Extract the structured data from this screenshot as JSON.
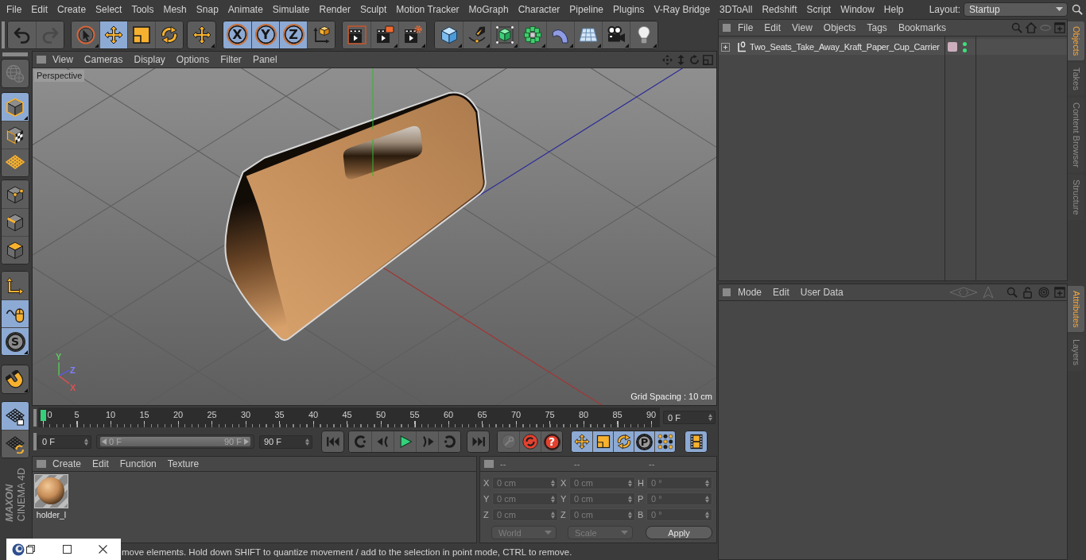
{
  "menu_bar": {
    "items": [
      "File",
      "Edit",
      "Create",
      "Select",
      "Tools",
      "Mesh",
      "Snap",
      "Animate",
      "Simulate",
      "Render",
      "Sculpt",
      "Motion Tracker",
      "MoGraph",
      "Character",
      "Pipeline",
      "Plugins",
      "V-Ray Bridge",
      "3DToAll",
      "Redshift",
      "Script",
      "Window",
      "Help"
    ],
    "layout_label": "Layout:",
    "layout_value": "Startup"
  },
  "toolbar": {
    "history": [
      {
        "kind": "undo",
        "disabled": false
      },
      {
        "kind": "redo",
        "disabled": true
      }
    ],
    "tools": [
      {
        "kind": "select",
        "selected": false
      },
      {
        "kind": "move",
        "selected": true
      },
      {
        "kind": "scale",
        "selected": false
      },
      {
        "kind": "rotate",
        "selected": false
      }
    ],
    "axes": [
      {
        "label": "X",
        "selected": true
      },
      {
        "label": "Y",
        "selected": true
      },
      {
        "label": "Z",
        "selected": true
      }
    ]
  },
  "mode_bar": {
    "globe_button": {
      "disabled": true
    },
    "modes": [
      {
        "kind": "model",
        "selected": true
      },
      {
        "kind": "texture",
        "selected": false
      },
      {
        "kind": "workplane",
        "selected": false
      },
      {
        "kind": "points",
        "selected": false
      },
      {
        "kind": "edges",
        "selected": false
      },
      {
        "kind": "polygons",
        "selected": false
      }
    ],
    "axis_button": {
      "selected": false
    },
    "mouse_button": {
      "selected": true
    },
    "solo_button": {
      "label": "S",
      "selected": true
    },
    "magnet_button": {
      "selected": false
    },
    "grid_lock_button": {
      "selected": true
    },
    "grid_rotate_button": {
      "selected": false
    },
    "logo": {
      "brand": "MAXON",
      "product": "CINEMA 4D"
    }
  },
  "viewport": {
    "menu": [
      "View",
      "Cameras",
      "Display",
      "Options",
      "Filter",
      "Panel"
    ],
    "camera_label": "Perspective",
    "grid_info": "Grid Spacing : 10 cm",
    "gizmo_labels": [
      {
        "text": "Y",
        "color": "#5fc85f"
      },
      {
        "text": "Z",
        "color": "#8080ff"
      },
      {
        "text": "X",
        "color": "#e05050"
      }
    ]
  },
  "timeline": {
    "ticks": [
      {
        "label": "0",
        "selected": true
      },
      {
        "label": "5",
        "selected": false
      },
      {
        "label": "10",
        "selected": false
      },
      {
        "label": "15",
        "selected": false
      },
      {
        "label": "20",
        "selected": false
      },
      {
        "label": "25",
        "selected": false
      },
      {
        "label": "30",
        "selected": false
      },
      {
        "label": "35",
        "selected": false
      },
      {
        "label": "40",
        "selected": false
      },
      {
        "label": "45",
        "selected": false
      },
      {
        "label": "50",
        "selected": false
      },
      {
        "label": "55",
        "selected": false
      },
      {
        "label": "60",
        "selected": false
      },
      {
        "label": "65",
        "selected": false
      },
      {
        "label": "70",
        "selected": false
      },
      {
        "label": "75",
        "selected": false
      },
      {
        "label": "80",
        "selected": false
      },
      {
        "label": "85",
        "selected": false
      },
      {
        "label": "90",
        "selected": false
      }
    ],
    "current_frame": "0 F"
  },
  "transport": {
    "start_frame": "0 F",
    "range_slider": {
      "start": "0 F",
      "end": "90 F",
      "level": 1
    },
    "end_frame": "90 F",
    "key_tools": [
      {
        "kind": "key",
        "disabled": true
      },
      {
        "kind": "record",
        "disabled": false
      },
      {
        "kind": "question",
        "label": "?",
        "disabled": false
      }
    ],
    "key_tracks": [
      {
        "kind": "position",
        "selected": true
      },
      {
        "kind": "scale",
        "selected": true
      },
      {
        "kind": "rotation",
        "selected": true
      },
      {
        "kind": "parameter",
        "label": "P",
        "selected": true
      },
      {
        "kind": "points",
        "selected": true
      }
    ],
    "timeline_button": {
      "selected": true
    }
  },
  "materials": {
    "menu": [
      "Create",
      "Edit",
      "Function",
      "Texture"
    ],
    "items": [
      {
        "name": "holder_l"
      }
    ]
  },
  "coordinates": {
    "headers": [
      "--",
      "--",
      "--"
    ],
    "columns": [
      [
        {
          "axis": "X",
          "value": "0 cm"
        },
        {
          "axis": "Y",
          "value": "0 cm"
        },
        {
          "axis": "Z",
          "value": "0 cm"
        }
      ],
      [
        {
          "axis": "X",
          "value": "0 cm"
        },
        {
          "axis": "Y",
          "value": "0 cm"
        },
        {
          "axis": "Z",
          "value": "0 cm"
        }
      ],
      [
        {
          "axis": "H",
          "value": "0 °"
        },
        {
          "axis": "P",
          "value": "0 °"
        },
        {
          "axis": "B",
          "value": "0 °"
        }
      ]
    ],
    "dropdowns": [
      "World",
      "Scale"
    ],
    "apply": "Apply"
  },
  "status_bar": {
    "text": "move elements. Hold down SHIFT to quantize movement / add to the selection in point mode, CTRL to remove."
  },
  "objects_manager": {
    "menu": [
      "File",
      "Edit",
      "View",
      "Objects",
      "Tags",
      "Bookmarks"
    ],
    "objects": [
      {
        "name": "Two_Seats_Take_Away_Kraft_Paper_Cup_Carrier",
        "expanded": false,
        "color": "#cdaebd",
        "editor_visible": true,
        "render_visible": true
      }
    ]
  },
  "attributes_manager": {
    "menu": [
      "Mode",
      "Edit",
      "User Data"
    ],
    "navigation": [
      {
        "kind": "history",
        "disabled": true
      },
      {
        "kind": "parent",
        "disabled": true
      }
    ]
  },
  "dock_tabs": {
    "upper": [
      {
        "label": "Objects",
        "selected": true
      },
      {
        "label": "Takes",
        "selected": false
      },
      {
        "label": "Content Browser",
        "selected": false
      },
      {
        "label": "Structure",
        "selected": false
      }
    ],
    "lower": [
      {
        "label": "Attributes",
        "selected": true
      },
      {
        "label": "Layers",
        "selected": false
      }
    ]
  }
}
